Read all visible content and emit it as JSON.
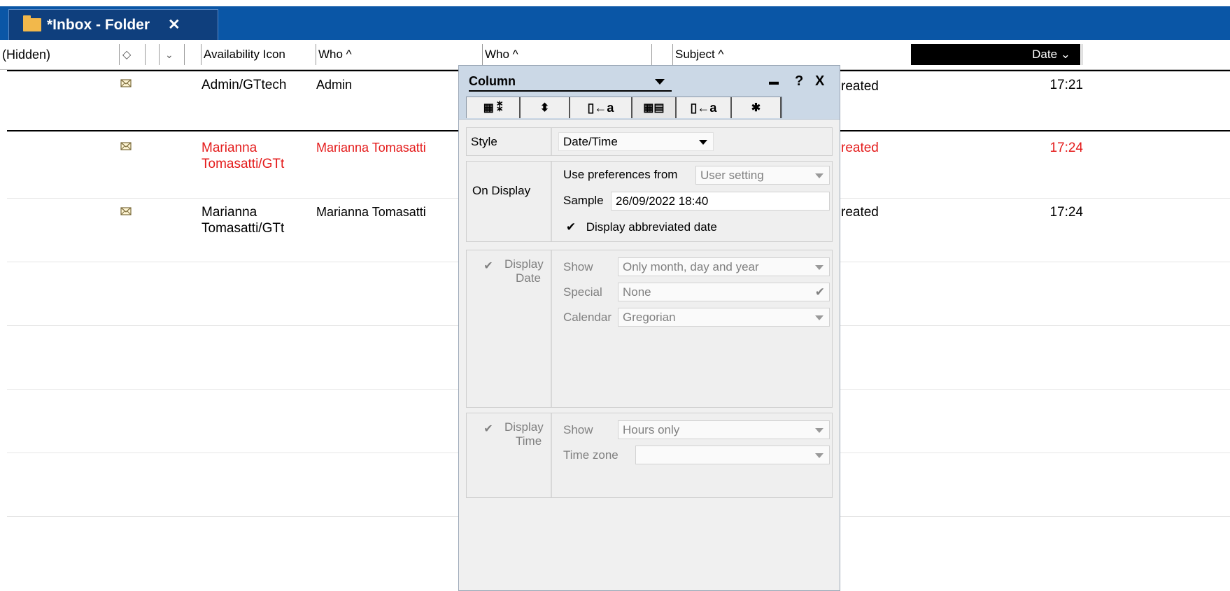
{
  "tab": {
    "title": "*Inbox - Folder",
    "close": "✕"
  },
  "columns": {
    "hidden": "(Hidden)",
    "sort_icon": "◇",
    "dropdown_icon": "⌄",
    "availability": "Availability Icon",
    "who1": "Who ^",
    "who2": "Who ^",
    "subject": "Subject ^",
    "date": "Date ⌄"
  },
  "rows": [
    {
      "who_full": "Admin/GTtech",
      "who_short": "Admin",
      "subject": "reated",
      "date": "17:21",
      "unread": false
    },
    {
      "who_full": "Marianna Tomasatti/GTt",
      "who_short": "Marianna Tomasatti",
      "subject": "reated",
      "date": "17:24",
      "unread": true
    },
    {
      "who_full": "Marianna Tomasatti/GTt",
      "who_short": "Marianna Tomasatti",
      "subject": "reated",
      "date": "17:24",
      "unread": false
    }
  ],
  "dialog": {
    "title": "Column",
    "btn_minimize": "▬",
    "btn_help": "?",
    "btn_close": "X",
    "tabs": [
      "▦ ⁑",
      "⬍",
      "▯←a",
      "▦▤",
      "▯←a",
      "✱"
    ],
    "style": {
      "label": "Style",
      "value": "Date/Time"
    },
    "on_display": {
      "label": "On Display",
      "pref_label": "Use preferences from",
      "pref_value": "User setting",
      "sample_label": "Sample",
      "sample_value": "26/09/2022 18:40",
      "abbrev_check": "✔",
      "abbrev_label": "Display abbreviated date"
    },
    "display_date": {
      "check": "✔",
      "label_line1": "Display",
      "label_line2": "Date",
      "show_label": "Show",
      "show_value": "Only month, day and year",
      "special_label": "Special",
      "special_value": "None",
      "special_check": "✔",
      "calendar_label": "Calendar",
      "calendar_value": "Gregorian"
    },
    "display_time": {
      "check": "✔",
      "label_line1": "Display",
      "label_line2": "Time",
      "show_label": "Show",
      "show_value": "Hours only",
      "tz_label": "Time zone",
      "tz_value": ""
    }
  }
}
